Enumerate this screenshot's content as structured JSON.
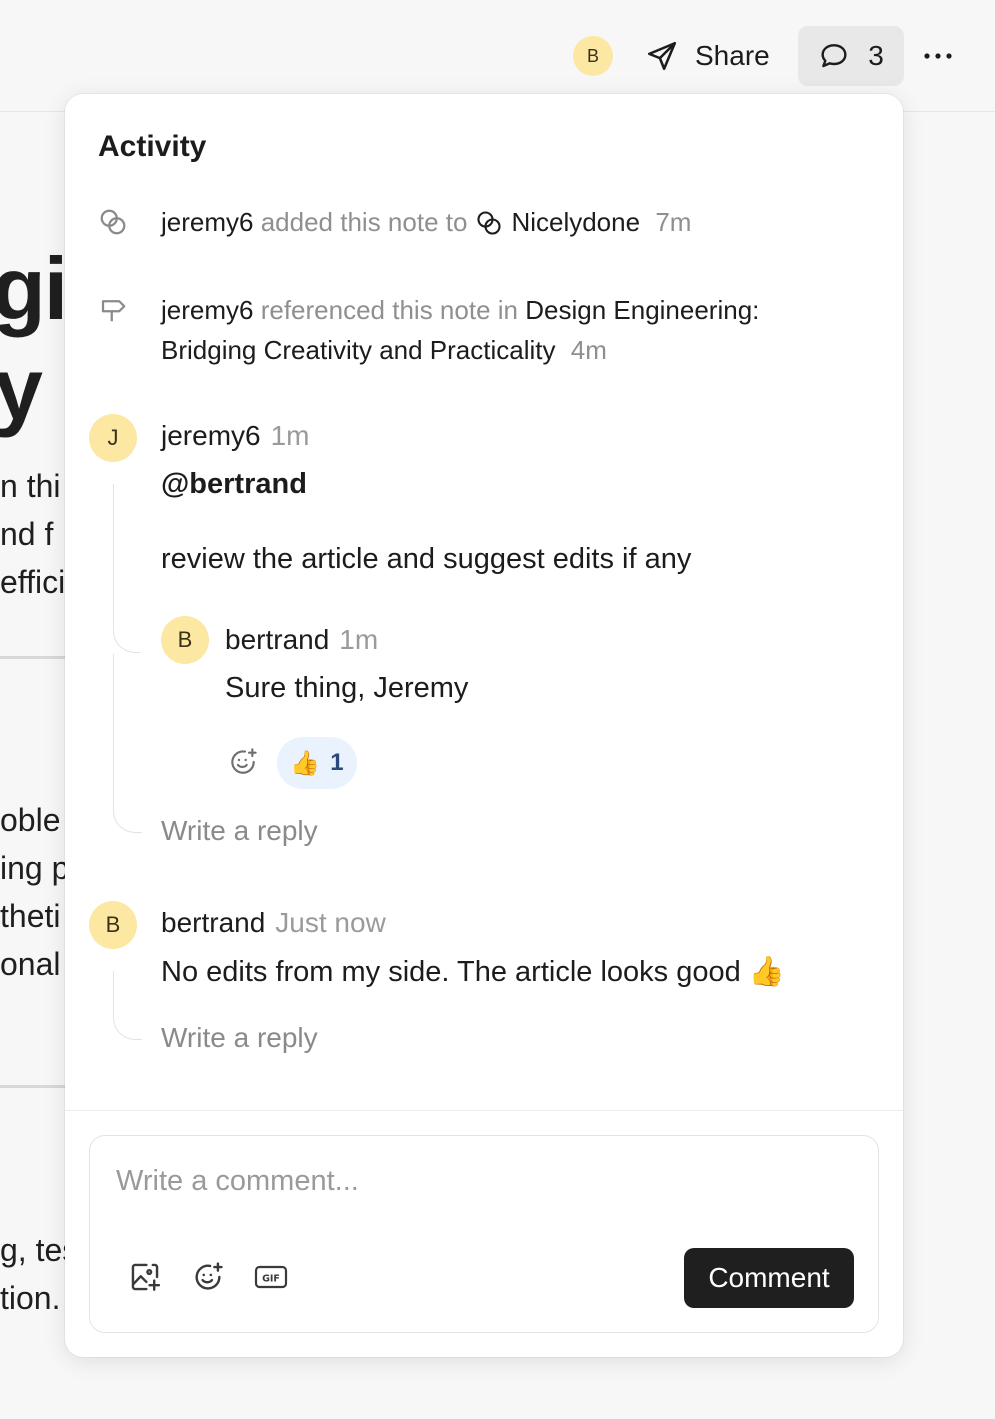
{
  "topbar": {
    "avatar_initial": "B",
    "share_label": "Share",
    "comment_count": "3"
  },
  "background_doc": {
    "heading_line1": "gi",
    "heading_line2": "y",
    "lines": [
      "n thi",
      "nd f",
      "effici",
      "oble",
      "ing p",
      "theti",
      "onal",
      "g, tes",
      "tion."
    ]
  },
  "activity": {
    "title": "Activity",
    "events": [
      {
        "user": "jeremy6",
        "action": "added this note to",
        "target": "Nicelydone",
        "time": "7m"
      },
      {
        "user": "jeremy6",
        "action": "referenced this note in",
        "target_line1": "Design Engineering:",
        "target_line2": "Bridging Creativity and Practicality",
        "time": "4m"
      }
    ],
    "threads": [
      {
        "initial": "J",
        "author": "jeremy6",
        "time": "1m",
        "mention": "@bertrand",
        "text": "review the article and suggest edits if any",
        "reply": {
          "initial": "B",
          "author": "bertrand",
          "time": "1m",
          "text": "Sure thing, Jeremy",
          "reaction_emoji": "👍",
          "reaction_count": "1"
        },
        "reply_placeholder": "Write a reply"
      },
      {
        "initial": "B",
        "author": "bertrand",
        "time": "Just now",
        "text": "No edits from my side. The article looks good",
        "emoji": "👍",
        "reply_placeholder": "Write a reply"
      }
    ]
  },
  "composer": {
    "placeholder": "Write a comment...",
    "submit_label": "Comment",
    "gif_label": "GIF"
  }
}
